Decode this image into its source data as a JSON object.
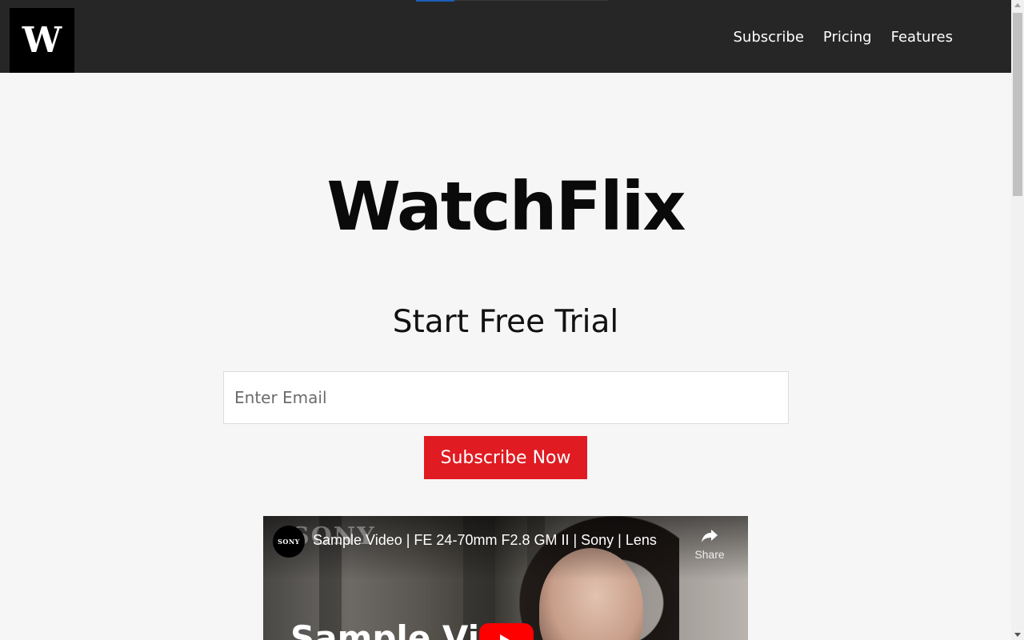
{
  "header": {
    "logo_letter": "W",
    "nav": [
      {
        "label": "Subscribe"
      },
      {
        "label": "Pricing"
      },
      {
        "label": "Features"
      }
    ]
  },
  "hero": {
    "brand": "WatchFlix",
    "heading": "Start Free Trial",
    "email_placeholder": "Enter Email",
    "email_value": "",
    "cta_label": "Subscribe Now"
  },
  "video": {
    "channel_label": "SONY",
    "watermark": "SONY",
    "title": "Sample Video | FE 24-70mm F2.8 GM II | Sony | Lens",
    "share_label": "Share",
    "caption": "Sample Vic",
    "play_icon": "play-icon",
    "share_icon": "share-arrow-icon"
  },
  "colors": {
    "header_bg": "#262626",
    "page_bg": "#f6f6f6",
    "cta_bg": "#e01b22",
    "youtube_red": "#ff0000"
  }
}
